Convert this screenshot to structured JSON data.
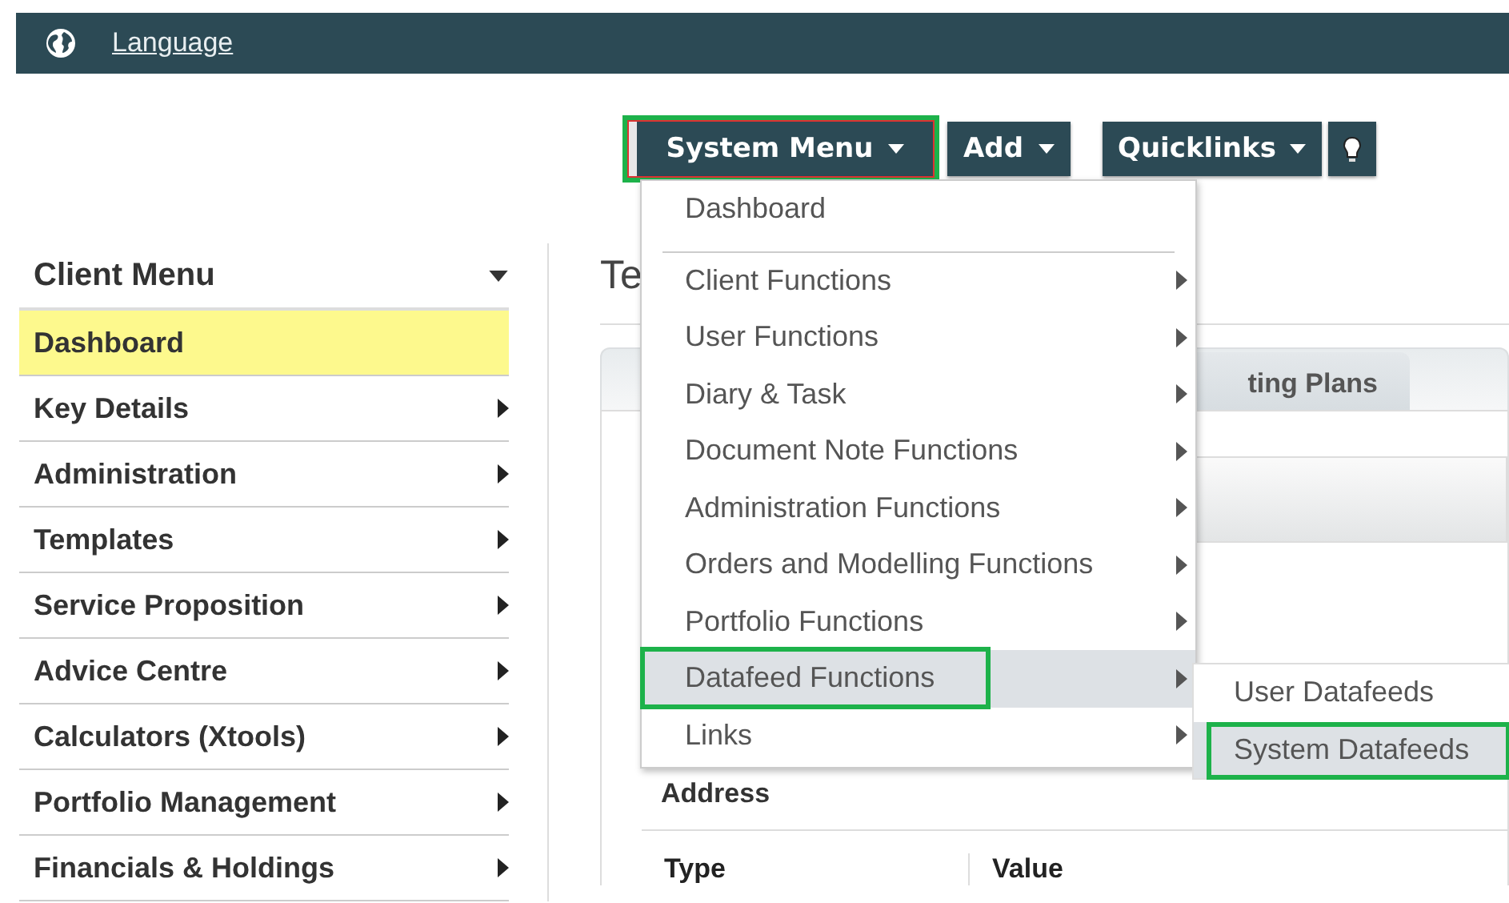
{
  "top_bar": {
    "language_link": "Language"
  },
  "toolbar": {
    "buttons": [
      {
        "label": "System Menu",
        "highlighted": true,
        "caret": true
      },
      {
        "label": "Add",
        "highlighted": false,
        "caret": true
      },
      {
        "label": "Quicklinks",
        "highlighted": false,
        "caret": true
      }
    ]
  },
  "sidebar": {
    "title": "Client Menu",
    "items": [
      {
        "label": "Dashboard",
        "selected": true,
        "submenu": false
      },
      {
        "label": "Key Details",
        "selected": false,
        "submenu": true
      },
      {
        "label": "Administration",
        "selected": false,
        "submenu": true
      },
      {
        "label": "Templates",
        "selected": false,
        "submenu": true
      },
      {
        "label": "Service Proposition",
        "selected": false,
        "submenu": true
      },
      {
        "label": "Advice Centre",
        "selected": false,
        "submenu": true
      },
      {
        "label": "Calculators (Xtools)",
        "selected": false,
        "submenu": true
      },
      {
        "label": "Portfolio Management",
        "selected": false,
        "submenu": true
      },
      {
        "label": "Financials & Holdings",
        "selected": false,
        "submenu": true
      }
    ]
  },
  "content": {
    "heading": "Te",
    "tabs": [
      {
        "label": "ting Plans",
        "selected": false
      }
    ],
    "section_label": "Address",
    "table": {
      "columns": [
        "Type",
        "Value"
      ]
    }
  },
  "system_menu": {
    "items": [
      {
        "label": "Dashboard",
        "submenu": false,
        "selected": false,
        "highlighted": false,
        "divider_after": true
      },
      {
        "label": "Client Functions",
        "submenu": true,
        "selected": false,
        "highlighted": false,
        "divider_after": false
      },
      {
        "label": "User Functions",
        "submenu": true,
        "selected": false,
        "highlighted": false,
        "divider_after": false
      },
      {
        "label": "Diary & Task",
        "submenu": true,
        "selected": false,
        "highlighted": false,
        "divider_after": false
      },
      {
        "label": "Document Note Functions",
        "submenu": true,
        "selected": false,
        "highlighted": false,
        "divider_after": false
      },
      {
        "label": "Administration Functions",
        "submenu": true,
        "selected": false,
        "highlighted": false,
        "divider_after": false
      },
      {
        "label": "Orders and Modelling Functions",
        "submenu": true,
        "selected": false,
        "highlighted": false,
        "divider_after": false
      },
      {
        "label": "Portfolio Functions",
        "submenu": true,
        "selected": false,
        "highlighted": false,
        "divider_after": false
      },
      {
        "label": "Datafeed Functions",
        "submenu": true,
        "selected": true,
        "highlighted": true,
        "divider_after": false
      },
      {
        "label": "Links",
        "submenu": true,
        "selected": false,
        "highlighted": false,
        "divider_after": false
      }
    ]
  },
  "submenu": {
    "items": [
      {
        "label": "User Datafeeds",
        "selected": false,
        "highlighted": false
      },
      {
        "label": "System Datafeeds",
        "selected": true,
        "highlighted": true
      }
    ]
  }
}
